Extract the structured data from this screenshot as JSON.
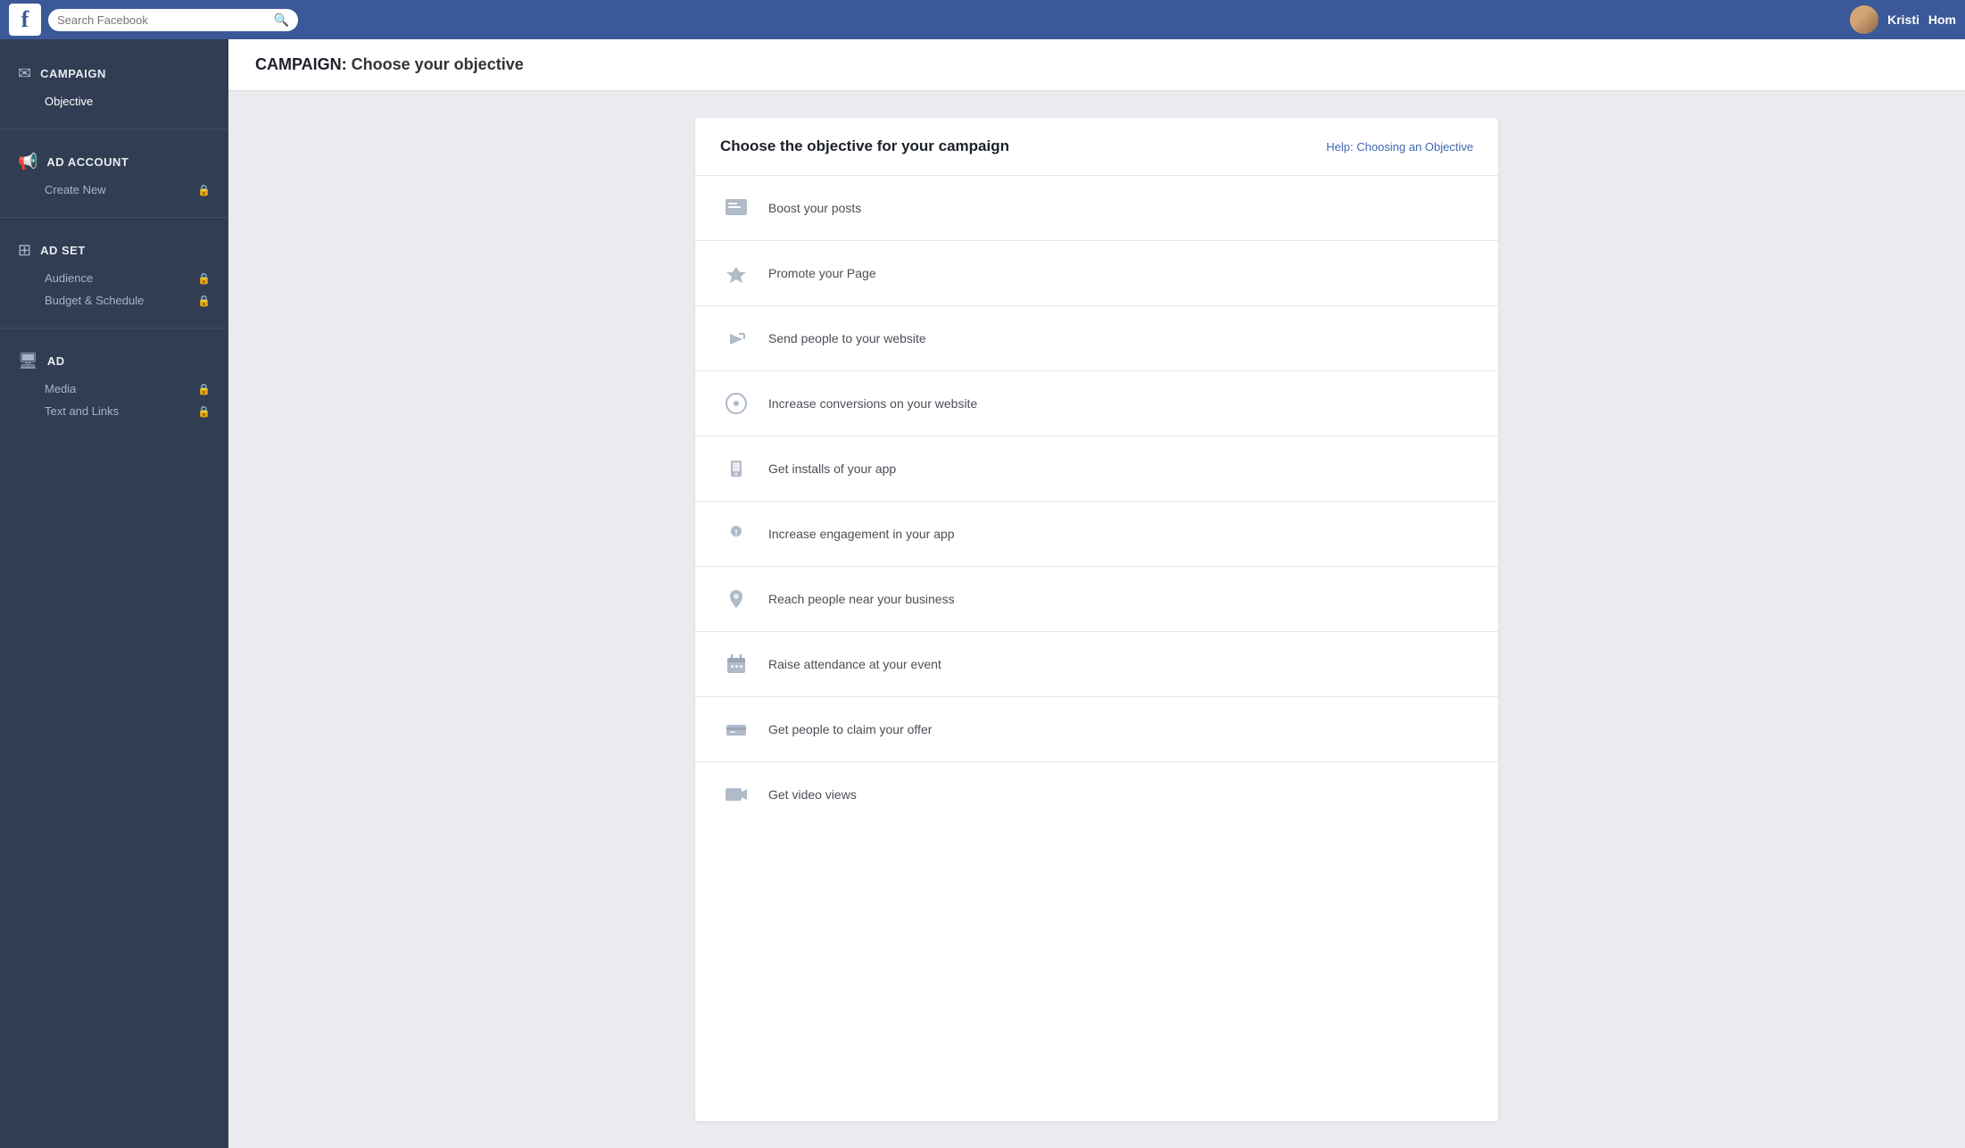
{
  "topNav": {
    "logoText": "f",
    "searchPlaceholder": "Search Facebook",
    "userName": "Kristi",
    "homeLabel": "Hom"
  },
  "pageHeader": {
    "sectionLabel": "CAMPAIGN:",
    "subtitle": "Choose your objective"
  },
  "sidebar": {
    "sections": [
      {
        "id": "campaign",
        "icon": "✉",
        "title": "CAMPAIGN",
        "items": [
          {
            "label": "Objective",
            "locked": false,
            "active": true
          }
        ]
      },
      {
        "id": "ad-account",
        "icon": "📢",
        "title": "AD ACCOUNT",
        "items": [
          {
            "label": "Create New",
            "locked": true,
            "active": false
          }
        ]
      },
      {
        "id": "ad-set",
        "icon": "⊞",
        "title": "AD SET",
        "items": [
          {
            "label": "Audience",
            "locked": true,
            "active": false
          },
          {
            "label": "Budget & Schedule",
            "locked": true,
            "active": false
          }
        ]
      },
      {
        "id": "ad",
        "icon": "🖥",
        "title": "AD",
        "items": [
          {
            "label": "Media",
            "locked": true,
            "active": false
          },
          {
            "label": "Text and Links",
            "locked": true,
            "active": false
          }
        ]
      }
    ]
  },
  "objectiveCard": {
    "title": "Choose the objective for your campaign",
    "helpLink": "Help: Choosing an Objective",
    "objectives": [
      {
        "id": "boost-posts",
        "icon": "📋",
        "label": "Boost your posts"
      },
      {
        "id": "promote-page",
        "icon": "👍",
        "label": "Promote your Page"
      },
      {
        "id": "send-website",
        "icon": "↗",
        "label": "Send people to your website"
      },
      {
        "id": "increase-conversions",
        "icon": "🌐",
        "label": "Increase conversions on your website"
      },
      {
        "id": "get-installs",
        "icon": "📦",
        "label": "Get installs of your app"
      },
      {
        "id": "increase-engagement",
        "icon": "🔑",
        "label": "Increase engagement in your app"
      },
      {
        "id": "reach-nearby",
        "icon": "📍",
        "label": "Reach people near your business"
      },
      {
        "id": "raise-attendance",
        "icon": "🗓",
        "label": "Raise attendance at your event"
      },
      {
        "id": "claim-offer",
        "icon": "🎟",
        "label": "Get people to claim your offer"
      },
      {
        "id": "video-views",
        "icon": "🎬",
        "label": "Get video views"
      }
    ]
  }
}
